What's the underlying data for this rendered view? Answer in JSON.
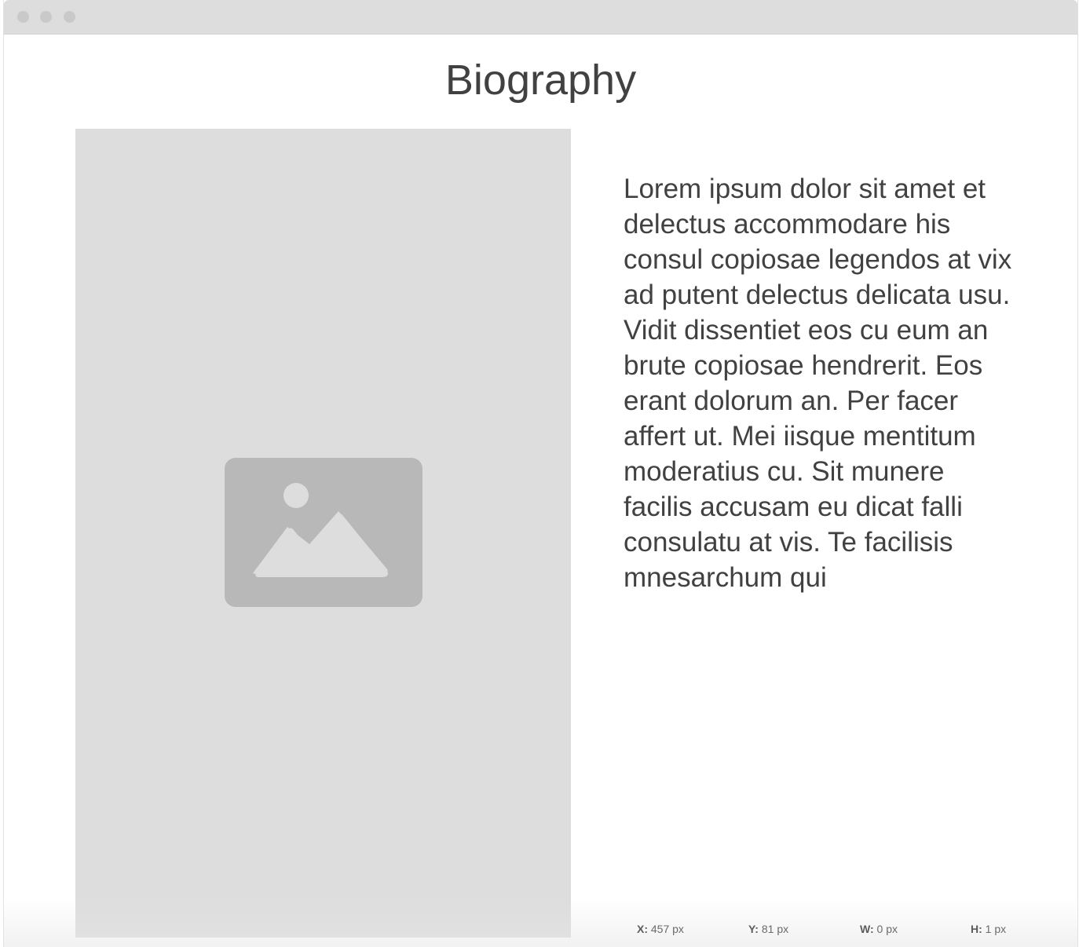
{
  "page": {
    "title": "Biography"
  },
  "image": {
    "icon": "image-placeholder-icon"
  },
  "bio": {
    "text": "Lorem ipsum dolor sit amet et delectus accommodare his consul copiosae legendos at vix ad putent delectus delicata usu. Vidit dissentiet eos cu eum an brute copiosae hendrerit. Eos erant dolorum an. Per facer affert ut. Mei iisque mentitum moderatius cu. Sit munere facilis accusam eu dicat falli consulatu at vis. Te facilisis mnesarchum qui"
  },
  "status": {
    "x_label": "X:",
    "x_value": "457 px",
    "y_label": "Y:",
    "y_value": "81 px",
    "w_label": "W:",
    "w_value": "0 px",
    "h_label": "H:",
    "h_value": "1 px"
  },
  "colors": {
    "placeholder_bg": "#dddddd",
    "placeholder_icon": "#b8b8b8",
    "text": "#414141"
  }
}
